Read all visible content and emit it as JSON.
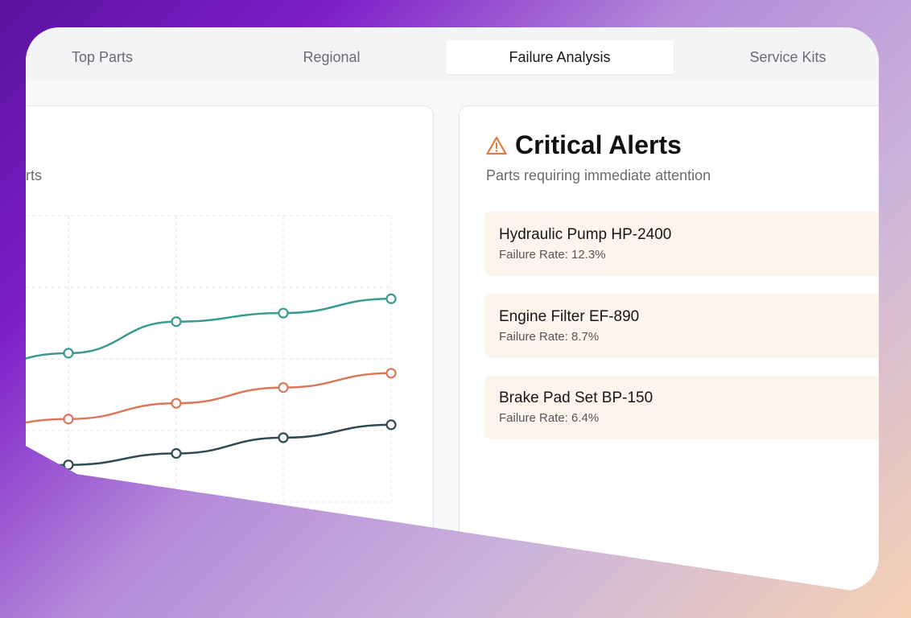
{
  "tabs": [
    {
      "label": "Top Parts"
    },
    {
      "label": "Regional"
    },
    {
      "label": "Failure Analysis"
    },
    {
      "label": "Service Kits"
    }
  ],
  "left_panel": {
    "subtitle_fragment": "rts"
  },
  "chart_data": {
    "type": "line",
    "x_points": 5,
    "series": [
      {
        "color": "#3a9a92",
        "values": [
          4.6,
          5.2,
          6.3,
          6.6,
          7.1
        ]
      },
      {
        "color": "#d9785a",
        "values": [
          2.5,
          2.9,
          3.45,
          4.0,
          4.5
        ]
      },
      {
        "color": "#2f4a55",
        "values": [
          1.0,
          1.3,
          1.7,
          2.25,
          2.7
        ]
      }
    ],
    "ylim": [
      0,
      10
    ],
    "grid": true
  },
  "alerts": {
    "icon": "warning-triangle-icon",
    "title": "Critical Alerts",
    "subtitle": "Parts requiring immediate attention",
    "items": [
      {
        "name": "Hydraulic Pump HP-2400",
        "rate": "Failure Rate: 12.3%"
      },
      {
        "name": "Engine Filter EF-890",
        "rate": "Failure Rate: 8.7%"
      },
      {
        "name": "Brake Pad Set BP-150",
        "rate": "Failure Rate: 6.4%"
      }
    ],
    "accent": "#e07a3a"
  }
}
